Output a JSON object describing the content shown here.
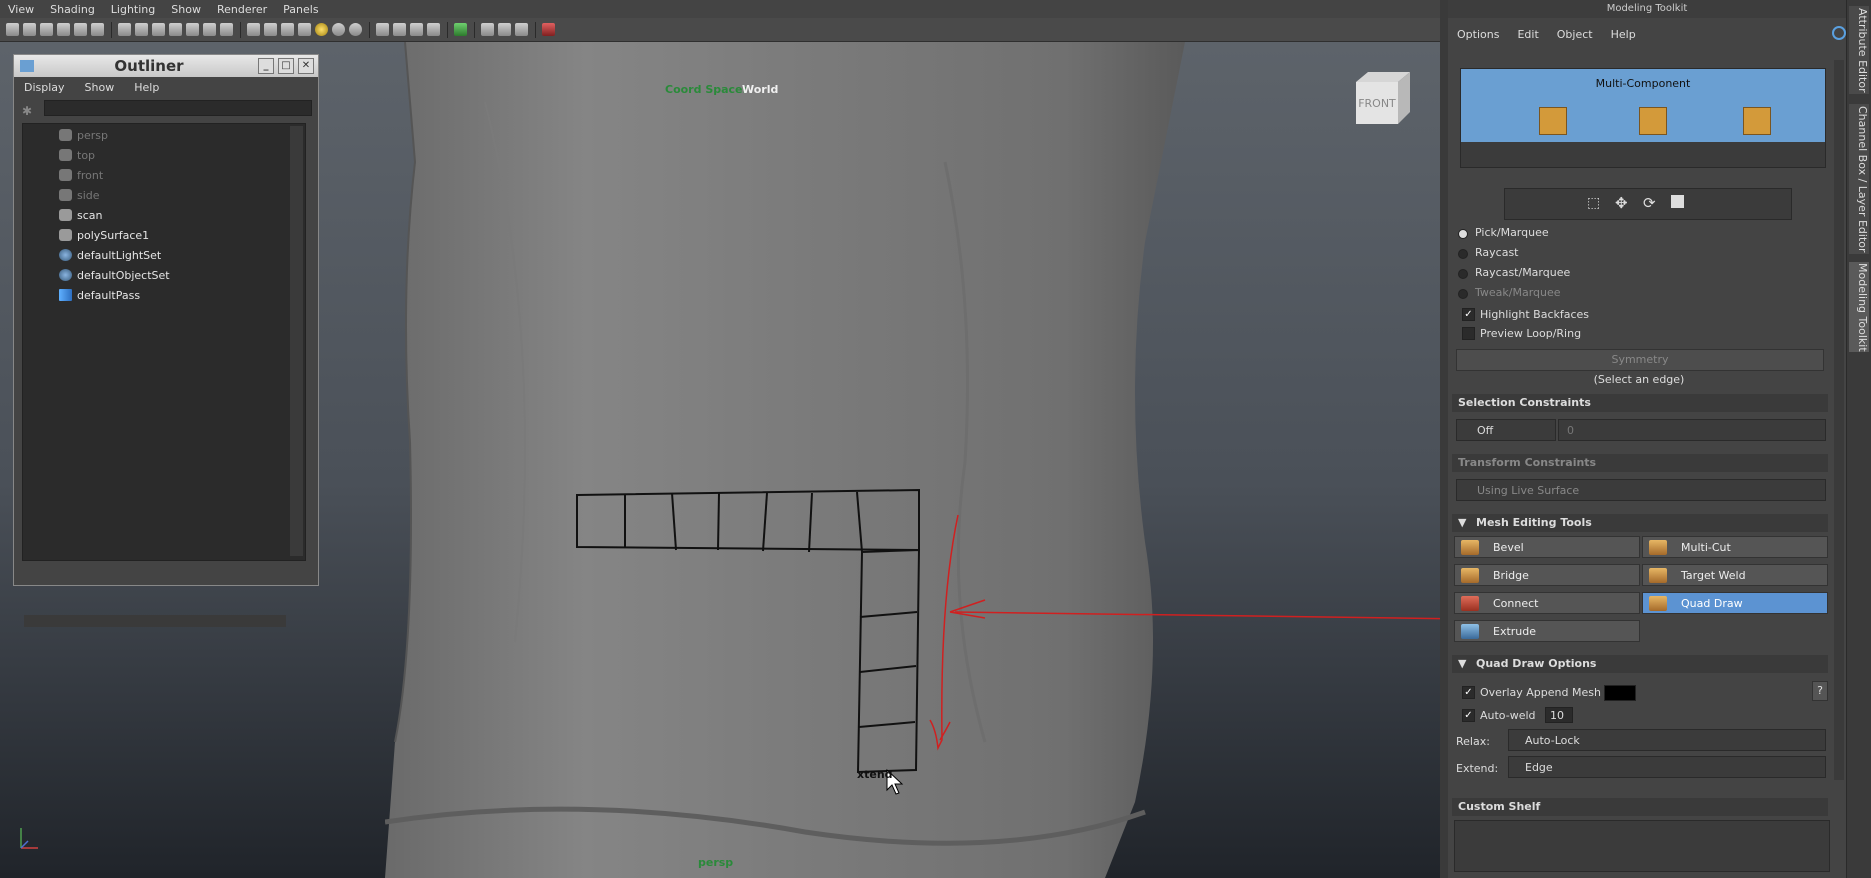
{
  "viewport": {
    "menu": [
      "View",
      "Shading",
      "Lighting",
      "Show",
      "Renderer",
      "Panels"
    ],
    "coord_space_label": "Coord Space:",
    "coord_space_value": "World",
    "camera_label": "persp",
    "viewcube_front": "FRONT",
    "cursor_hint": "xtend"
  },
  "outliner": {
    "title": "Outliner",
    "menu": [
      "Display",
      "Show",
      "Help"
    ],
    "items": [
      {
        "label": "persp",
        "state": "dim",
        "icon": "camera-icon"
      },
      {
        "label": "top",
        "state": "dim",
        "icon": "camera-icon"
      },
      {
        "label": "front",
        "state": "dim",
        "icon": "camera-icon"
      },
      {
        "label": "side",
        "state": "dim",
        "icon": "camera-icon"
      },
      {
        "label": "scan",
        "state": "lit",
        "icon": "mesh-icon"
      },
      {
        "label": "polySurface1",
        "state": "lit",
        "icon": "mesh-icon"
      },
      {
        "label": "defaultLightSet",
        "state": "lit",
        "icon": "set-icon"
      },
      {
        "label": "defaultObjectSet",
        "state": "lit",
        "icon": "set-icon"
      },
      {
        "label": "defaultPass",
        "state": "lit",
        "icon": "render-pass-icon"
      }
    ]
  },
  "toolkit": {
    "title": "Modeling Toolkit",
    "menu": [
      "Options",
      "Edit",
      "Object",
      "Help"
    ],
    "multi_component": "Multi-Component",
    "selection_modes": [
      {
        "label": "Pick/Marquee",
        "selected": true,
        "disabled": false
      },
      {
        "label": "Raycast",
        "selected": false,
        "disabled": false
      },
      {
        "label": "Raycast/Marquee",
        "selected": false,
        "disabled": false
      },
      {
        "label": "Tweak/Marquee",
        "selected": false,
        "disabled": true
      }
    ],
    "highlight_backfaces": "Highlight Backfaces",
    "preview_loop_ring": "Preview Loop/Ring",
    "symmetry": "Symmetry",
    "select_edge_hint": "(Select an edge)",
    "selection_constraints": {
      "header": "Selection Constraints",
      "value": "Off",
      "number": "0"
    },
    "transform_constraints": {
      "header": "Transform Constraints",
      "value": "Using Live Surface"
    },
    "mesh_editing_tools": {
      "header": "Mesh Editing Tools",
      "tools": [
        "Bevel",
        "Multi-Cut",
        "Bridge",
        "Target Weld",
        "Connect",
        "Quad Draw",
        "Extrude"
      ],
      "active": "Quad Draw"
    },
    "quad_draw_options": {
      "header": "Quad Draw Options",
      "overlay_append_mesh": "Overlay Append Mesh",
      "auto_weld": "Auto-weld",
      "auto_weld_value": "10",
      "relax_label": "Relax:",
      "relax_value": "Auto-Lock",
      "extend_label": "Extend:",
      "extend_value": "Edge",
      "help": "?"
    },
    "custom_shelf": "Custom Shelf"
  },
  "side_tabs": [
    "Attribute Editor",
    "Channel Box / Layer Editor",
    "Modeling Toolkit"
  ],
  "colors": {
    "active_blue": "#5c93d2",
    "accent_red": "#d02020",
    "label_green": "#2a8a3a"
  }
}
